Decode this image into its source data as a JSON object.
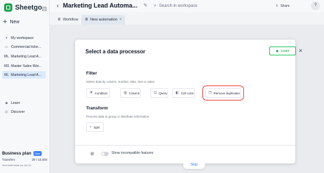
{
  "brand": {
    "name": "Sheetgo"
  },
  "sidebar": {
    "new_label": "New",
    "items": [
      {
        "label": "My workspace",
        "icon": "chevron-down-icon"
      },
      {
        "label": "Commercial ticke...",
        "icon": "folder-icon"
      },
      {
        "label": "Marketing Lead A...",
        "icon": "ML"
      },
      {
        "label": "Master Sales Wor...",
        "icon": "MS"
      },
      {
        "label": "Marketing Lead A...",
        "icon": "ML"
      },
      {
        "label": "Learn",
        "icon": "graduation-cap-icon"
      },
      {
        "label": "Discover",
        "icon": "compass-icon"
      }
    ],
    "plan": {
      "title": "Business plan",
      "badge": "New",
      "transfers_label": "Transfers",
      "transfers_value": "29 / 10,000",
      "note": "Your trial ends on Jul 21"
    }
  },
  "header": {
    "title": "Marketing Lead Automa...",
    "search_placeholder": "Search in workspace",
    "share_label": "Share"
  },
  "tabs": [
    {
      "label": "Workflow"
    },
    {
      "label": "New automation"
    }
  ],
  "modal": {
    "title": "Select a data processor",
    "learn_label": "Learn",
    "filter": {
      "title": "Filter",
      "subtitle": "Select data by column, number, date, text or value",
      "options": [
        {
          "label": "Condition",
          "icon": "filter-icon"
        },
        {
          "label": "Column",
          "icon": "columns-icon"
        },
        {
          "label": "Query",
          "icon": "query-icon"
        },
        {
          "label": "Cell color",
          "icon": "paint-bucket-icon"
        },
        {
          "label": "Remove duplicates",
          "icon": "duplicates-icon"
        }
      ]
    },
    "transform": {
      "title": "Transform",
      "subtitle": "Process data to group or distribute information",
      "options": [
        {
          "label": "Split",
          "icon": "split-icon"
        }
      ]
    },
    "toggle_label": "Show incompatible features"
  },
  "skip_label": "Skip",
  "colors": {
    "brand_green": "#16a34a",
    "accent_blue": "#3b82f6",
    "highlight_red": "#ef4444"
  }
}
